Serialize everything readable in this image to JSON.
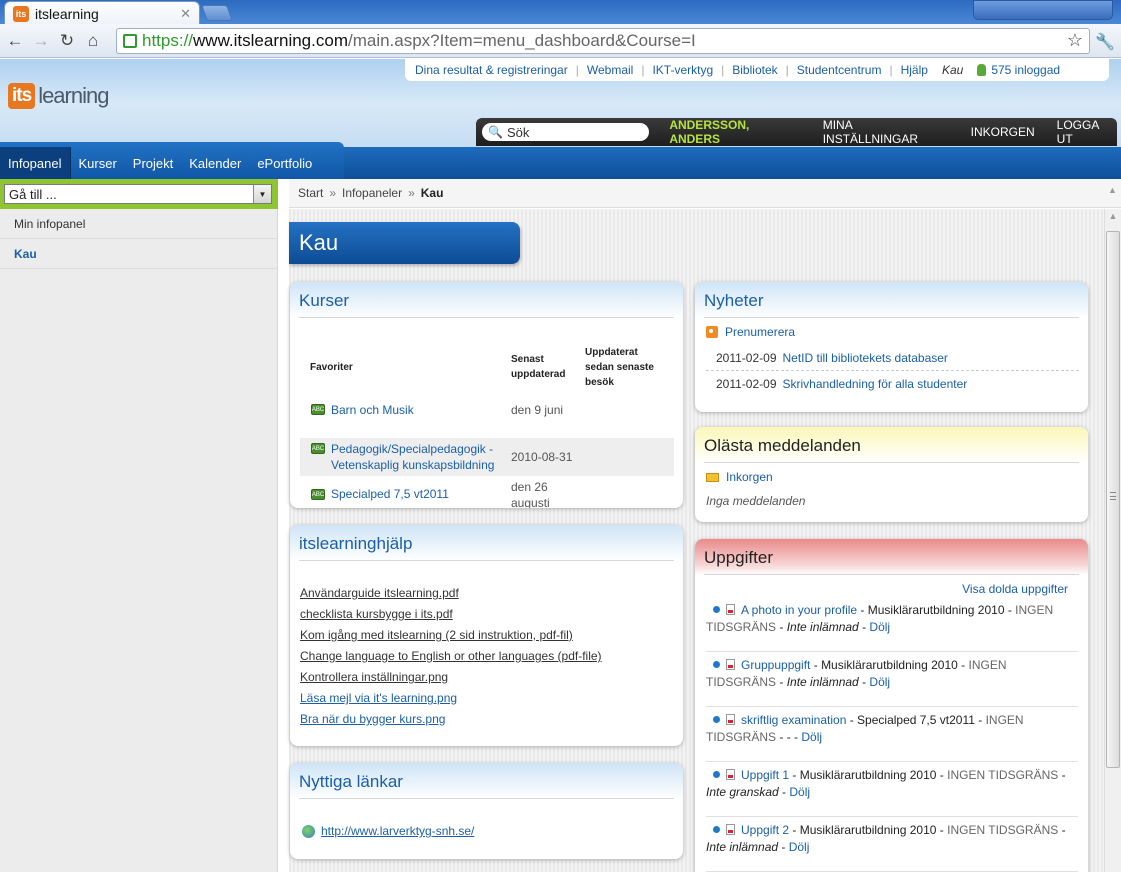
{
  "browser": {
    "tab_title": "itslearning",
    "tab_favicon": "its",
    "url_scheme": "https://",
    "url_host": "www.itslearning.com",
    "url_path": "/main.aspx?Item=menu_dashboard&Course=I"
  },
  "header": {
    "logo_its": "its",
    "logo_learning": "learning",
    "top_links": [
      "Dina resultat & registreringar",
      "Webmail",
      "IKT-verktyg",
      "Bibliotek",
      "Studentcentrum",
      "Hjälp"
    ],
    "current_context": "Kau",
    "online_count": "575 inloggad",
    "search_placeholder": "Sök",
    "user_name": "ANDERSSON, ANDERS",
    "user_links": [
      "MINA INSTÄLLNINGAR",
      "INKORGEN",
      "LOGGA UT"
    ]
  },
  "nav": {
    "tabs": [
      "Infopanel",
      "Kurser",
      "Projekt",
      "Kalender",
      "ePortfolio"
    ],
    "active": "Infopanel"
  },
  "sidebar": {
    "goto_label": "Gå till ...",
    "items": [
      "Min infopanel",
      "Kau"
    ],
    "active": "Kau"
  },
  "breadcrumb": [
    "Start",
    "Infopaneler",
    "Kau"
  ],
  "page_title": "Kau",
  "kurser": {
    "title": "Kurser",
    "col_favorites": "Favoriter",
    "col_updated_line1": "Senast",
    "col_updated_line2": "uppdaterad",
    "col_since_line1": "Uppdaterat",
    "col_since_line2": "sedan senaste",
    "col_since_line3": "besök",
    "icon_label": "ABC",
    "rows": [
      {
        "name_line1": "Barn och Musik",
        "name_line2": "",
        "date_line1": "den 9 juni",
        "date_line2": ""
      },
      {
        "name_line1": "Pedagogik/Specialpedagogik -",
        "name_line2": "Vetenskaplig kunskapsbildning",
        "date_line1": "2010-08-31",
        "date_line2": ""
      },
      {
        "name_line1": "Specialped 7,5 vt2011",
        "name_line2": "",
        "date_line1": "den 26",
        "date_line2": "augusti"
      }
    ]
  },
  "help": {
    "title": "itslearninghjälp",
    "links": [
      "Användarguide itslearning.pdf",
      "checklista kursbygge i its.pdf",
      "Kom igång med itslearning (2 sid instruktion, pdf-fil)",
      "Change language to English or other languages (pdf-file)",
      "Kontrollera inställningar.png",
      "Läsa mejl via it's learning.png",
      "Bra när du bygger kurs.png"
    ]
  },
  "useful_links": {
    "title": "Nyttiga länkar",
    "link": "http://www.larverktyg-snh.se/"
  },
  "news": {
    "title": "Nyheter",
    "subscribe": "Prenumerera",
    "items": [
      {
        "date": "2011-02-09",
        "title": "NetID till bibliotekets databaser"
      },
      {
        "date": "2011-02-09",
        "title": "Skrivhandledning för alla studenter"
      }
    ]
  },
  "unread": {
    "title": "Olästa meddelanden",
    "inbox": "Inkorgen",
    "empty": "Inga meddelanden"
  },
  "tasks": {
    "title": "Uppgifter",
    "show_hidden": "Visa dolda uppgifter",
    "items": [
      {
        "name": "A photo in your profile",
        "course": "Musiklärarutbildning 2010",
        "deadline_a": "INGEN",
        "deadline_b": "TIDSGRÄNS",
        "status": "Inte inlämnad",
        "hide": "Dölj"
      },
      {
        "name": "Gruppuppgift",
        "course": "Musiklärarutbildning 2010",
        "deadline_a": "INGEN",
        "deadline_b": "TIDSGRÄNS",
        "status": "Inte inlämnad",
        "hide": "Dölj"
      },
      {
        "name": "skriftlig examination",
        "course": "Specialped 7,5 vt2011",
        "deadline_a": "INGEN",
        "deadline_b": "TIDSGRÄNS",
        "status": "-",
        "hide": "Dölj"
      },
      {
        "name": "Uppgift 1",
        "course": "Musiklärarutbildning 2010",
        "deadline_a": "INGEN TIDSGRÄNS",
        "deadline_b": "",
        "status": "Inte granskad",
        "hide": "Dölj"
      },
      {
        "name": "Uppgift 2",
        "course": "Musiklärarutbildning 2010",
        "deadline_a": "INGEN TIDSGRÄNS",
        "deadline_b": "",
        "status": "Inte inlämnad",
        "hide": "Dölj"
      }
    ]
  },
  "colors": {
    "brand_orange": "#e87722",
    "nav_blue": "#1057a6",
    "link_blue": "#1a5fa8",
    "user_green": "#b7e33d",
    "goto_green": "#8fc433"
  }
}
